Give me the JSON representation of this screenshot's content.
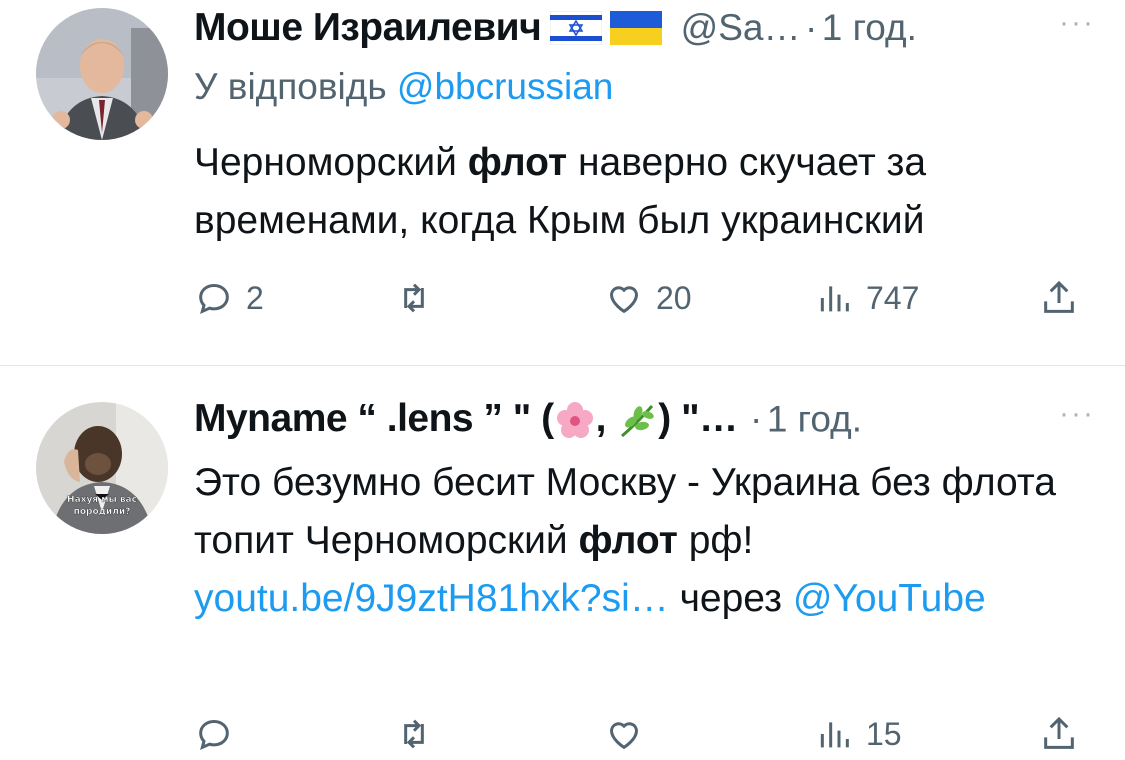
{
  "tweets": [
    {
      "display_name": "Моше Израилевич",
      "handle": "@Sa…",
      "separator": "·",
      "time": "1 год.",
      "reply_label": "У відповідь",
      "reply_to": "@bbcrussian",
      "text_before": "Черноморский ",
      "text_bold": "флот",
      "text_after": " наверно скучает за временами, когда Крым был украинский",
      "stats": {
        "replies": "2",
        "retweets": "",
        "likes": "20",
        "views": "747"
      }
    },
    {
      "display_name": "Myname “ .lens ” \" (",
      "display_name_mid": ", ",
      "display_name_end": ") \"…",
      "separator": "·",
      "time": "1 год.",
      "avatar_caption": "Нахуя мы вас породили?",
      "text_before": "Это безумно бесит Москву - Украина без флота топит Черноморский ",
      "text_bold": "флот",
      "text_after": " рф! ",
      "link": "youtu.be/9J9ztH81hxk?si…",
      "via": " через ",
      "via_mention": "@YouTube",
      "stats": {
        "replies": "",
        "retweets": "",
        "likes": "",
        "views": "15"
      }
    }
  ],
  "more_label": "···",
  "icons": [
    "reply-icon",
    "retweet-icon",
    "like-icon",
    "views-icon",
    "share-icon"
  ],
  "colors": {
    "accent": "#1d9bf0",
    "secondary_text": "#536471",
    "divider": "#e1e6ea"
  }
}
